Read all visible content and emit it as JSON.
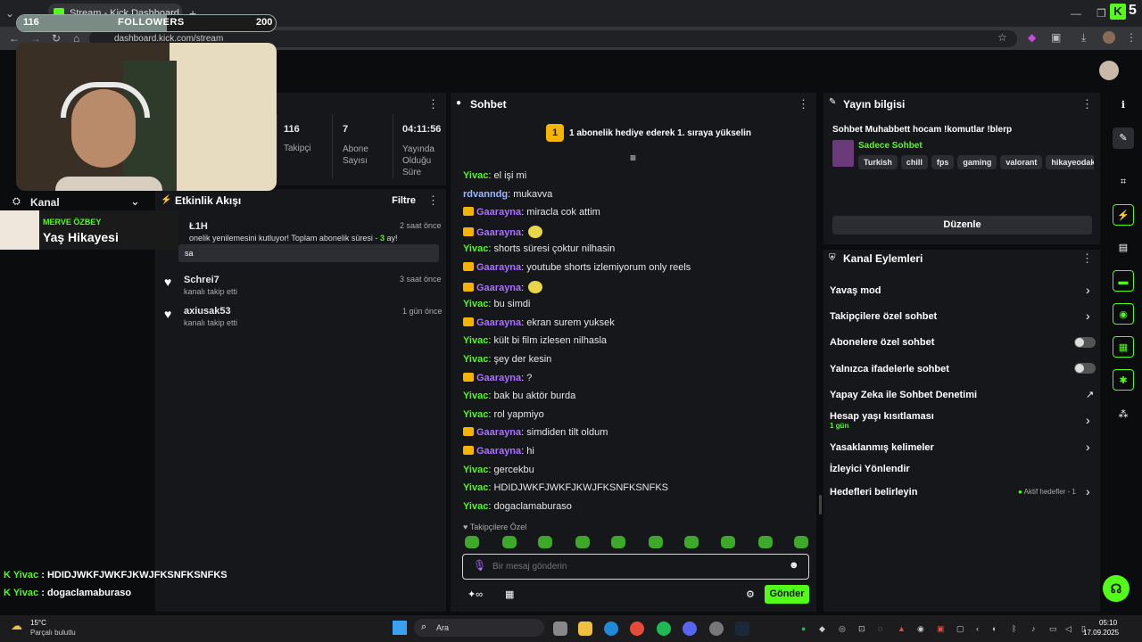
{
  "browser": {
    "tab_title": "Stream - Kick Dashboard",
    "new_tab": "+",
    "url": "dashboard.kick.com/stream"
  },
  "overlay": {
    "followers_current": "116",
    "followers_label": "FOLLOWERS",
    "followers_goal": "200",
    "followers_progress": 0.58,
    "channel_label": "Kanal",
    "banner_name": "MERVE ÖZBEY",
    "banner_title": "Yaş Hikayesi",
    "chat_1_user": "Yivac",
    "chat_1_text": "HDIDJWKFJWKFJKWJFKSNFKSNFKS",
    "chat_2_user": "Yivac",
    "chat_2_text": "dogaclamaburaso",
    "separator": ":"
  },
  "stats": {
    "followers_value": "116",
    "followers_label": "Takipçi",
    "subs_value": "7",
    "subs_label": "Abone Sayısı",
    "time_value": "04:11:56",
    "time_label": "Yayında Olduğu Süre"
  },
  "activity": {
    "title": "Etkinlik Akışı",
    "filter": "Filtre",
    "items": [
      {
        "user": "Ł1H",
        "time": "2 saat önce",
        "desc": "onelik yenilemesini kutluyor! Toplam abonelik süresi - ",
        "count": "3",
        "unit": " ay!",
        "msg": "sa"
      },
      {
        "user": "Schrei7",
        "time": "3 saat önce",
        "desc": "kanalı takip etti"
      },
      {
        "user": "axiusak53",
        "time": "1 gün önce",
        "desc": "kanalı takip etti"
      }
    ]
  },
  "chat": {
    "title": "Sohbet",
    "promo_badge": "1",
    "promo": "1 abonelik hediye ederek 1. sıraya yükselin",
    "messages": [
      {
        "user": "Yivac",
        "c": "green",
        "text": "el işi mi"
      },
      {
        "user": "rdvanndg",
        "c": "blue",
        "text": "mukavva"
      },
      {
        "user": "Gaarayna",
        "c": "purple",
        "crown": true,
        "text": "miracla cok attim"
      },
      {
        "user": "Gaarayna",
        "c": "purple",
        "crown": true,
        "text": "",
        "emote": true
      },
      {
        "user": "Yivac",
        "c": "green",
        "text": "shorts süresi çoktur nilhasin"
      },
      {
        "user": "Gaarayna",
        "c": "purple",
        "crown": true,
        "text": "youtube shorts izlemiyorum only reels"
      },
      {
        "user": "Gaarayna",
        "c": "purple",
        "crown": true,
        "text": "",
        "emote": true
      },
      {
        "user": "Yivac",
        "c": "green",
        "text": "bu simdi"
      },
      {
        "user": "Gaarayna",
        "c": "purple",
        "crown": true,
        "text": "ekran surem yuksek"
      },
      {
        "user": "Yivac",
        "c": "green",
        "text": "kült bi film izlesen nilhasla"
      },
      {
        "user": "Yivac",
        "c": "green",
        "text": "şey der kesin"
      },
      {
        "user": "Gaarayna",
        "c": "purple",
        "crown": true,
        "text": "?"
      },
      {
        "user": "Yivac",
        "c": "green",
        "text": "bak bu aktör burda"
      },
      {
        "user": "Yivac",
        "c": "green",
        "text": "rol yapmiyo"
      },
      {
        "user": "Gaarayna",
        "c": "purple",
        "crown": true,
        "text": "simdiden tilt oldum"
      },
      {
        "user": "Gaarayna",
        "c": "purple",
        "crown": true,
        "text": "hi"
      },
      {
        "user": "Yivac",
        "c": "green",
        "text": "gercekbu"
      },
      {
        "user": "Yivac",
        "c": "green",
        "text": "HDIDJWKFJWKFJKWJFKSNFKSNFKS"
      },
      {
        "user": "Yivac",
        "c": "green",
        "text": "dogaclamaburaso"
      }
    ],
    "separator": ": ",
    "followers_only": "Takipçilere Özel",
    "input_placeholder": "Bir mesaj gönderin",
    "send": "Gönder"
  },
  "stream_info": {
    "title": "Yayın bilgisi",
    "stream_title": "Sohbet Muhabbett hocam !komutlar !blerp",
    "category": "Sadece Sohbet",
    "tags": [
      "Turkish",
      "chill",
      "fps",
      "gaming",
      "valorant",
      "hikayeodaklıoyu"
    ],
    "edit": "Düzenle"
  },
  "actions": {
    "title": "Kanal Eylemleri",
    "slow": "Yavaş mod",
    "followers_chat": "Takipçilere özel sohbet",
    "subs_chat": "Abonelere özel sohbet",
    "emote_chat": "Yalnızca ifadelerle sohbet",
    "ai_mod": "Yapay Zeka ile Sohbet Denetimi",
    "age": "Hesap yaşı kısıtlaması",
    "age_value": "1 gün",
    "banned_words": "Yasaklanmış kelimeler",
    "redirect": "İzleyici Yönlendir",
    "goals": "Hedefleri belirleyin",
    "goals_status": "Aktif hedefler - 1"
  },
  "taskbar": {
    "weather_temp": "15°C",
    "weather_desc": "Parçalı bulutlu",
    "search": "Ara",
    "time": "05:10",
    "date": "17.09.2025"
  },
  "colors": {
    "accent": "#53fc18",
    "purple": "#a970ff",
    "panel": "#16171b",
    "gold": "#f5b400"
  }
}
